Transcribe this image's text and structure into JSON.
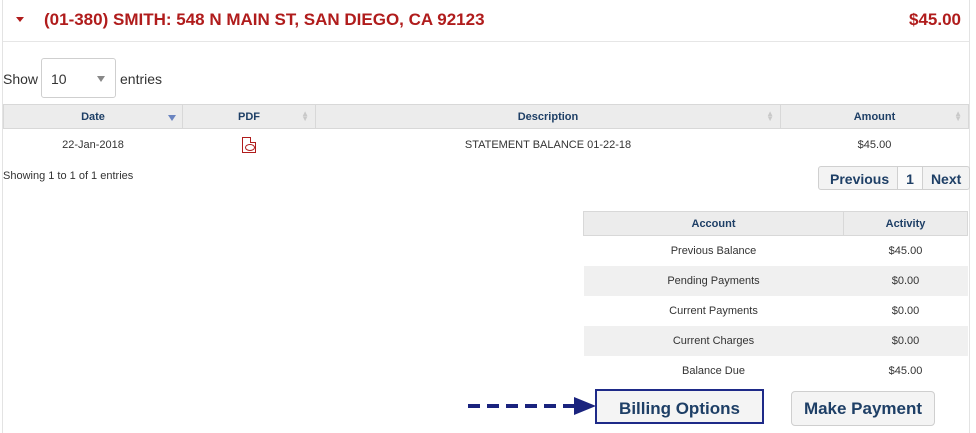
{
  "account": {
    "title": "(01-380) SMITH: 548 N MAIN ST, SAN DIEGO, CA 92123",
    "total": "$45.00"
  },
  "length_menu": {
    "show_label": "Show",
    "selected": "10",
    "entries_label": "entries"
  },
  "statements": {
    "columns": [
      "Date",
      "PDF",
      "Description",
      "Amount"
    ],
    "rows": [
      {
        "date": "22-Jan-2018",
        "description": "STATEMENT BALANCE 01-22-18",
        "amount": "$45.00"
      }
    ],
    "info": "Showing 1 to 1 of 1 entries"
  },
  "pagination": {
    "previous": "Previous",
    "page": "1",
    "next": "Next"
  },
  "summary": {
    "columns": [
      "Account",
      "Activity"
    ],
    "rows": [
      {
        "label": "Previous Balance",
        "value": "$45.00"
      },
      {
        "label": "Pending Payments",
        "value": "$0.00"
      },
      {
        "label": "Current Payments",
        "value": "$0.00"
      },
      {
        "label": "Current Charges",
        "value": "$0.00"
      },
      {
        "label": "Balance Due",
        "value": "$45.00"
      }
    ]
  },
  "actions": {
    "billing_options": "Billing Options",
    "make_payment": "Make Payment"
  },
  "icons": {
    "collapse": "caret-down-icon",
    "pdf": "pdf-file-icon",
    "pointer": "dashed-arrow-icon"
  },
  "colors": {
    "account_red": "#b01c1c",
    "header_blue": "#1e3f66",
    "highlight_border": "#1e2a88",
    "arrow": "#1a237e"
  }
}
